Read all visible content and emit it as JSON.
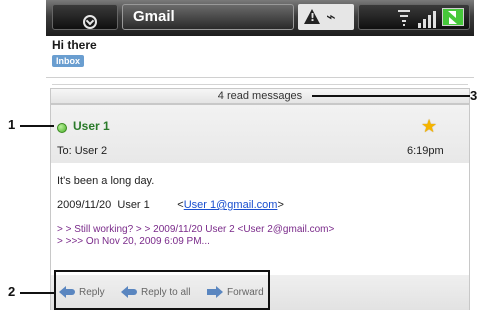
{
  "status_bar": {
    "app_title": "Gmail",
    "icons": [
      "menu-chevron-icon",
      "warning-icon",
      "usb-icon",
      "wifi-icon",
      "signal-icon",
      "battery-charging-icon"
    ]
  },
  "conversation": {
    "subject": "Hi there",
    "label": "Inbox",
    "collapsed_messages": "4 read messages"
  },
  "message": {
    "sender": "User 1",
    "to_line": "To: User 2",
    "time": "6:19pm",
    "body": "It's been a long day.",
    "quote_header_date": "2009/11/20",
    "quote_header_name": "User 1",
    "quote_header_email": "User 1@gmail.com",
    "quote_header_open": "<",
    "quote_header_close": ">",
    "quoted_line1": "> > Still working? > > 2009/11/20 User 2 <User 2@gmail.com>",
    "quoted_line2": "> >>> On Nov 20, 2009 6:09 PM..."
  },
  "actions": {
    "reply": "Reply",
    "reply_all": "Reply to all",
    "forward": "Forward"
  },
  "callouts": {
    "one": "1",
    "two": "2",
    "three": "3"
  },
  "colors": {
    "sender_green": "#2a7a2a",
    "label_blue": "#6a9ed0",
    "link_blue": "#1a4fcf",
    "quote_purple": "#7a2a8a",
    "star_yellow": "#f5b400"
  }
}
